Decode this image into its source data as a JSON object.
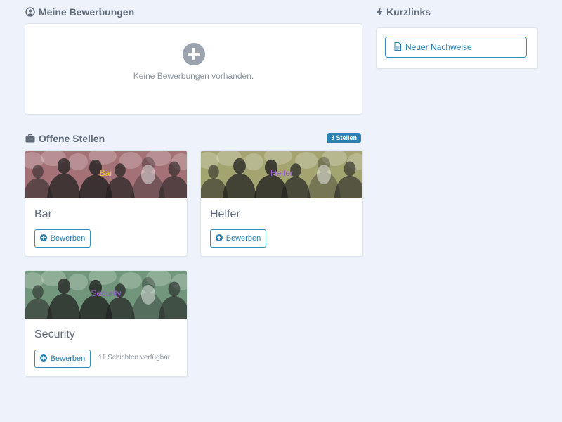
{
  "applications": {
    "title": "Meine Bewerbungen",
    "empty_message": "Keine Bewerbungen vorhanden."
  },
  "shortcuts": {
    "title": "Kurzlinks",
    "new_proof_label": "Neuer Nachweise"
  },
  "openings": {
    "title": "Offene Stellen",
    "count_badge": "3 Stellen",
    "jobs": [
      {
        "name": "Bar",
        "image_label": "Bar",
        "label_color": "#e8c630",
        "tint": "#c98a90",
        "apply_label": "Bewerben",
        "shift_info": ""
      },
      {
        "name": "Helfer",
        "image_label": "Helfer",
        "label_color": "#9b59d6",
        "tint": "#c9c88a",
        "apply_label": "Bewerben",
        "shift_info": ""
      },
      {
        "name": "Security",
        "image_label": "Security",
        "label_color": "#9b59d6",
        "tint": "#8ab896",
        "apply_label": "Bewerben",
        "shift_info": "11 Schichten verfügbar"
      }
    ]
  },
  "colors": {
    "accent": "#2a7fb3",
    "background": "#eef3fb"
  },
  "icons": {
    "applications": "user-circle-icon",
    "shortcuts": "bolt-icon",
    "openings": "briefcase-icon",
    "empty": "plus-circle-icon",
    "new_proof": "document-icon",
    "apply": "plus-circle-icon"
  }
}
